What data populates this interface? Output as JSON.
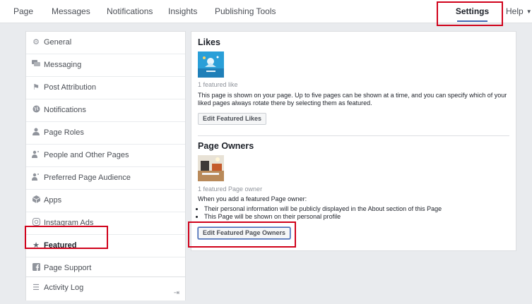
{
  "topnav": {
    "items": [
      "Page",
      "Messages",
      "Notifications",
      "Insights",
      "Publishing Tools"
    ],
    "settings": "Settings",
    "help": "Help"
  },
  "sidebar": {
    "items": [
      {
        "label": "General",
        "icon": "gear-icon"
      },
      {
        "label": "Messaging",
        "icon": "chat-icon"
      },
      {
        "label": "Post Attribution",
        "icon": "flag-icon"
      },
      {
        "label": "Notifications",
        "icon": "globe-icon"
      },
      {
        "label": "Page Roles",
        "icon": "person-icon"
      },
      {
        "label": "People and Other Pages",
        "icon": "people-icon"
      },
      {
        "label": "Preferred Page Audience",
        "icon": "audience-icon"
      },
      {
        "label": "Apps",
        "icon": "cube-icon"
      },
      {
        "label": "Instagram Ads",
        "icon": "instagram-icon"
      },
      {
        "label": "Featured",
        "icon": "star-icon"
      },
      {
        "label": "Page Support",
        "icon": "facebook-icon"
      }
    ],
    "activity_log": "Activity Log"
  },
  "likes": {
    "title": "Likes",
    "count_text": "1 featured like",
    "description": "This page is shown on your page. Up to five pages can be shown at a time, and you can specify which of your liked pages always rotate there by selecting them as featured.",
    "button": "Edit Featured Likes"
  },
  "owners": {
    "title": "Page Owners",
    "count_text": "1 featured Page owner",
    "intro": "When you add a featured Page owner:",
    "bullets": [
      "Their personal information will be publicly displayed in the About section of this Page",
      "This Page will be shown on their personal profile"
    ],
    "button": "Edit Featured Page Owners"
  },
  "colors": {
    "accent": "#4267b2",
    "highlight": "#d0021b"
  }
}
